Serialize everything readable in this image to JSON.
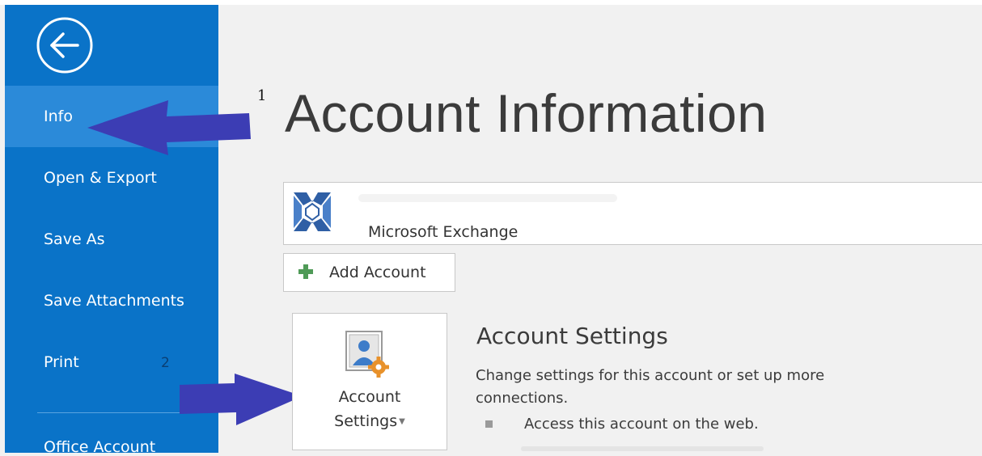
{
  "sidebar": {
    "back_label": "Back",
    "items": [
      {
        "label": "Info"
      },
      {
        "label": "Open & Export"
      },
      {
        "label": "Save As"
      },
      {
        "label": "Save Attachments"
      },
      {
        "label": "Print"
      }
    ],
    "cut_item_label": "Office Account"
  },
  "annotations": {
    "marker_1": "1",
    "marker_2": "2"
  },
  "main": {
    "title": "Account Information",
    "account": {
      "type": "Microsoft Exchange",
      "icon": "exchange-icon"
    },
    "add_account_label": "Add Account",
    "settings_tile": {
      "line1": "Account",
      "line2": "Settings",
      "icon": "account-settings-icon"
    },
    "account_settings": {
      "heading": "Account Settings",
      "desc_line1": "Change settings for this account or set up more",
      "desc_line2": "connections.",
      "link": "Access this account on the web."
    }
  },
  "colors": {
    "sidebar_bg": "#0a73c8",
    "sidebar_active": "#2b8ad9",
    "annotation_arrow": "#3c3db4",
    "page_bg": "#f1f1f1"
  }
}
